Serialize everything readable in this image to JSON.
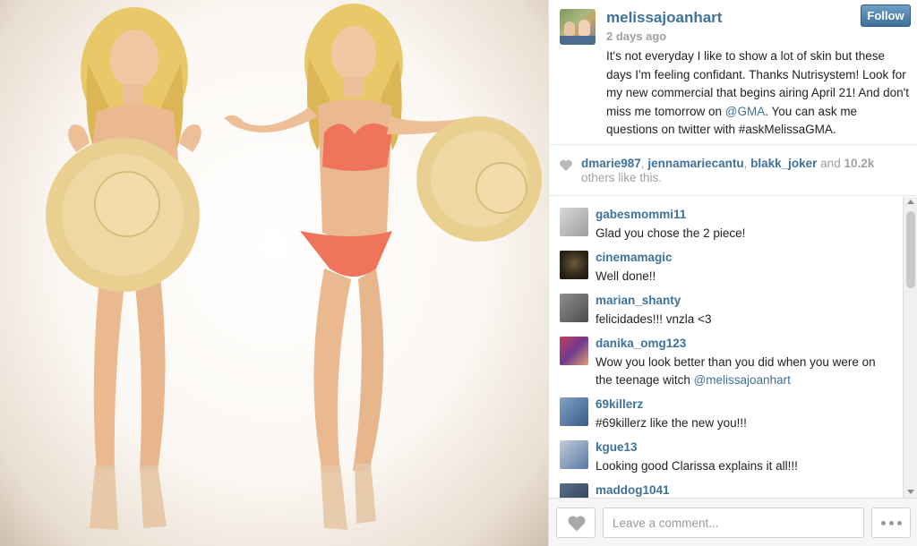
{
  "post": {
    "username": "melissajoanhart",
    "time": "2 days ago",
    "follow_label": "Follow",
    "caption_before": "It's not everyday I like to show a lot of skin but these days I'm feeling confidant. Thanks Nutrisystem! Look for my new commercial that begins airing April 21! And don't miss me tomorrow on ",
    "caption_mention": "@GMA",
    "caption_after": ". You can ask me questions on twitter with #askMelissaGMA."
  },
  "likes": {
    "user1": "dmarie987",
    "sep1": ", ",
    "user2": "jennamariecantu",
    "sep2": ", ",
    "user3": "blakk_joker",
    "and": " and ",
    "count": "10.2k",
    "suffix": "others like this."
  },
  "comments": [
    {
      "user": "gabesmommi11",
      "text": "Glad you chose the 2 piece!"
    },
    {
      "user": "cinemamagic",
      "text": "Well done!!"
    },
    {
      "user": "marian_shanty",
      "text": "felicidades!!! vnzla <3"
    },
    {
      "user": "danika_omg123",
      "text": "Wow you look better than you did when you were on the teenage witch ",
      "mention": "@melissajoanhart"
    },
    {
      "user": "69killerz",
      "text": "#69killerz like the new you!!!"
    },
    {
      "user": "kgue13",
      "text": "Looking good Clarissa explains it all!!!"
    },
    {
      "user": "maddog1041",
      "text": ""
    }
  ],
  "footer": {
    "comment_placeholder": "Leave a comment..."
  },
  "icons": {
    "heart": "heart-icon",
    "more": "more-dots-icon"
  },
  "colors": {
    "username": "#3f729b",
    "follow_button": "#3f729b",
    "muted": "#a0a0a0"
  }
}
